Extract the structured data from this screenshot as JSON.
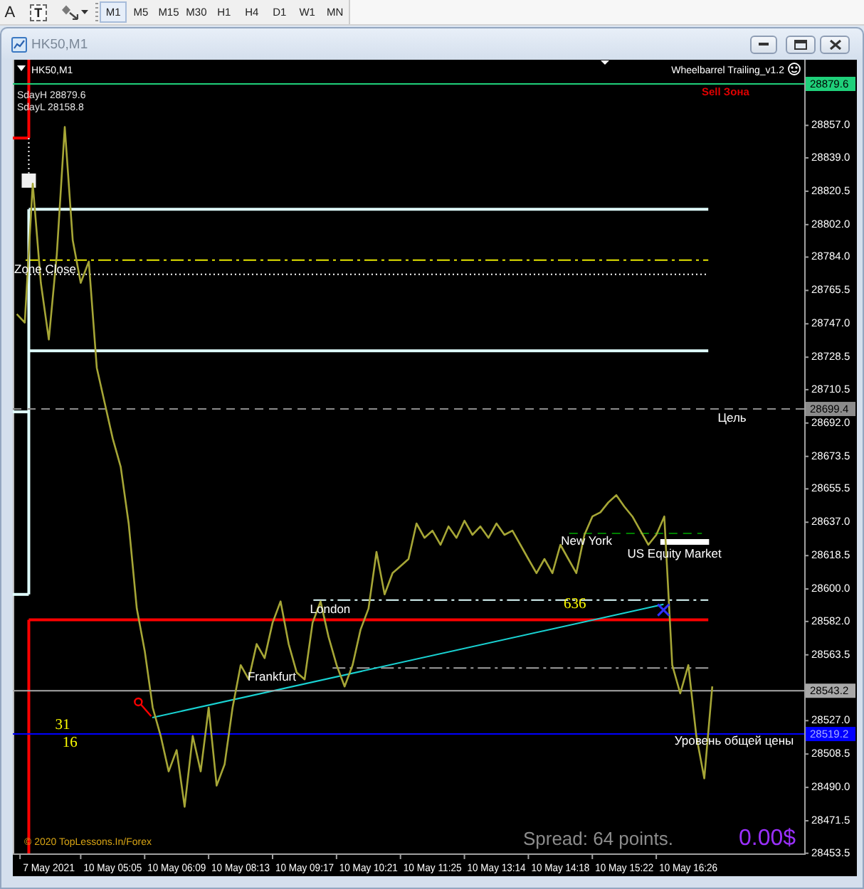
{
  "toolbar": {
    "tools": [
      {
        "kind": "text",
        "label": "A"
      },
      {
        "kind": "text_label",
        "label": "T"
      },
      {
        "kind": "shapes"
      }
    ],
    "periods": [
      {
        "label": "M1",
        "selected": true
      },
      {
        "label": "M5",
        "selected": false
      },
      {
        "label": "M15",
        "selected": false
      },
      {
        "label": "M30",
        "selected": false
      },
      {
        "label": "H1",
        "selected": false
      },
      {
        "label": "H4",
        "selected": false
      },
      {
        "label": "D1",
        "selected": false
      },
      {
        "label": "W1",
        "selected": false
      },
      {
        "label": "MN",
        "selected": false
      }
    ]
  },
  "window": {
    "title": "HK50,M1"
  },
  "chart": {
    "symbol": "HK50,M1",
    "expert": "Wheelbarrel Trailing_v1.2",
    "day_range": [
      "SdayH 28879.6",
      "SdayL 28158.8"
    ],
    "zone": "Sell Зона",
    "copyright": "© 2020 TopLessons.In/Forex",
    "spread": "Spread: 64 points.",
    "balance": "0.00$",
    "chart_data": {
      "type": "line",
      "categories": [
        null,
        null,
        null,
        null,
        "7 May 2021",
        null,
        null,
        null,
        null,
        null,
        null,
        null,
        "10 May 05:05",
        null,
        null,
        null,
        null,
        null,
        null,
        null,
        "10 May 06:09",
        null,
        null,
        null,
        null,
        null,
        null,
        null,
        "10 May 08:13",
        null,
        null,
        null,
        null,
        null,
        null,
        null,
        "10 May 09:17",
        null,
        null,
        null,
        null,
        null,
        null,
        null,
        "10 May 10:21",
        null,
        null,
        null,
        null,
        null,
        null,
        null,
        "10 May 11:25",
        null,
        null,
        null,
        null,
        null,
        null,
        null,
        "10 May 13:14",
        null,
        null,
        null,
        null,
        null,
        null,
        null,
        "10 May 14:18",
        null,
        null,
        null,
        null,
        null,
        null,
        null,
        "10 May 15:22",
        null,
        null,
        null,
        null,
        null,
        null,
        null,
        "10 May 16:26",
        null,
        null,
        null,
        null,
        null,
        null,
        null,
        null,
        null,
        null,
        null,
        null,
        null,
        null
      ],
      "values": [
        28752.0,
        28747.3,
        28824.3,
        28769.3,
        28737.9,
        28785.0,
        28855.7,
        28792.9,
        28769.3,
        28781.1,
        28722.2,
        28702.6,
        28683.0,
        28667.3,
        28635.9,
        28588.8,
        28565.2,
        28533.8,
        28518.1,
        28498.5,
        28510.3,
        28478.9,
        28518.1,
        28498.5,
        28533.8,
        28490.6,
        28502.4,
        28533.8,
        28557.4,
        28549.5,
        28569.1,
        28561.3,
        28580.9,
        28592.7,
        28569.1,
        28553.4,
        28549.5,
        28580.9,
        28592.7,
        28573.1,
        28557.4,
        28545.6,
        28557.4,
        28577.0,
        28588.8,
        28620.2,
        28596.6,
        28608.4,
        28612.3,
        28616.2,
        28635.9,
        28628.0,
        28631.9,
        28624.1,
        28634.3,
        28628.0,
        28637.4,
        28629.6,
        28634.3,
        28628.0,
        28635.9,
        28629.6,
        28631.9,
        28624.1,
        28616.2,
        28608.4,
        28616.2,
        28608.4,
        28624.1,
        28616.2,
        28608.4,
        28629.6,
        28639.8,
        28642.1,
        28647.6,
        28651.6,
        28645.3,
        28639.8,
        28631.9,
        28624.1,
        28629.6,
        28639.8,
        28557.4,
        28541.7,
        28557.4,
        28518.1,
        28494.6,
        28545.6,
        null,
        null,
        null,
        null,
        null,
        null,
        null,
        null,
        null,
        null,
        null
      ],
      "ylim": [
        28453,
        28893
      ],
      "yticks": [
        {
          "value": 28857,
          "label": "28857.0"
        },
        {
          "value": 28839,
          "label": "28839.0"
        },
        28820.5,
        {
          "value": 28802,
          "label": "28802.0"
        },
        {
          "value": 28784,
          "label": "28784.0"
        },
        28765.5,
        {
          "value": 28747,
          "label": "28747.0"
        },
        28728.5,
        28710.5,
        {
          "value": 28692,
          "label": "28692.0"
        },
        28673.5,
        28655.5,
        {
          "value": 28637,
          "label": "28637.0"
        },
        28618.5,
        {
          "value": 28600,
          "label": "28600.0"
        },
        {
          "value": 28582,
          "label": "28582.0"
        },
        28563.5,
        {
          "value": 28527,
          "label": "28527.0"
        },
        28508.5,
        {
          "value": 28490,
          "label": "28490.0"
        },
        28471.5,
        28453.5
      ],
      "ref_lines": [
        {
          "axis": "y",
          "value": 28879.6,
          "label": "28879.6",
          "color": "#1fd07a"
        },
        {
          "axis": "y",
          "value": 28699.4,
          "label": "28699.4",
          "color": "#8c8c8c"
        },
        {
          "axis": "y",
          "value": 28543.2,
          "label": "28543.2",
          "color": "#a8a8a8"
        },
        {
          "axis": "y",
          "value": 28519.2,
          "label": "28519.2",
          "color": "#0000ff"
        }
      ],
      "annotations": [
        "Zone Close",
        "Цель",
        "New York",
        "US Equity Market",
        "London",
        "636",
        "Frankfurt",
        "31",
        "16",
        "Уровень общей цены"
      ]
    }
  }
}
